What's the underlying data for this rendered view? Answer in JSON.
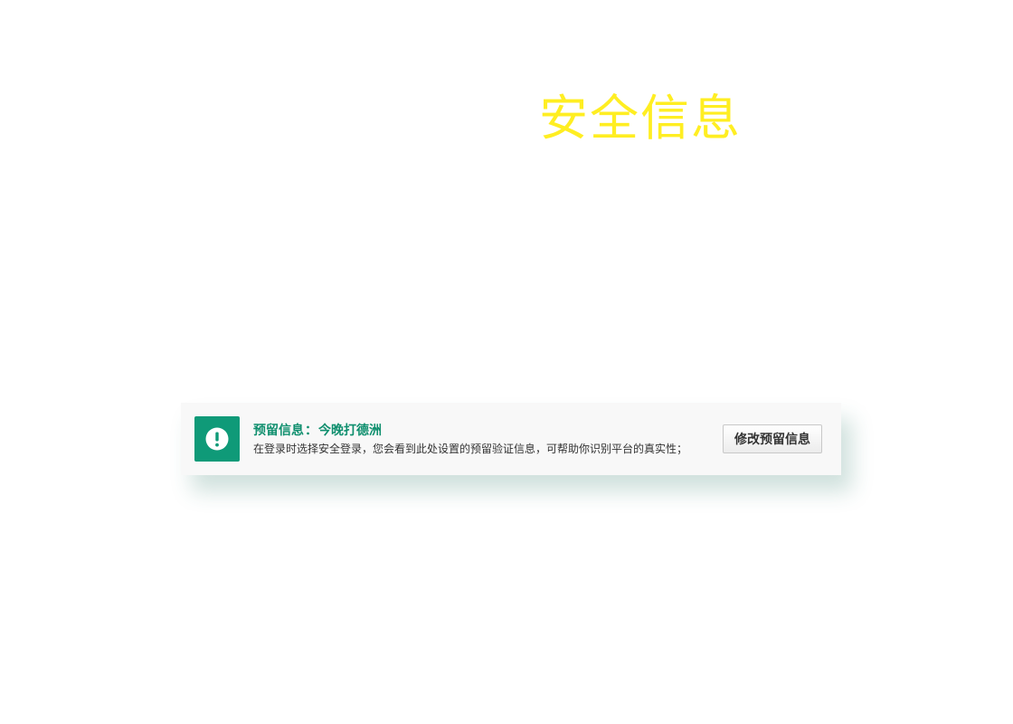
{
  "page": {
    "title": "安全信息"
  },
  "notice": {
    "icon": "exclamation-circle-icon",
    "label": "预留信息",
    "separator": "：",
    "value": "今晚打德洲",
    "description": "在登录时选择安全登录，您会看到此处设置的预留验证信息，可帮助你识别平台的真实性；",
    "button_label": "修改预留信息"
  },
  "colors": {
    "title": "#ffee22",
    "accent": "#0f9a78",
    "accent_text": "#0f8f6e"
  }
}
